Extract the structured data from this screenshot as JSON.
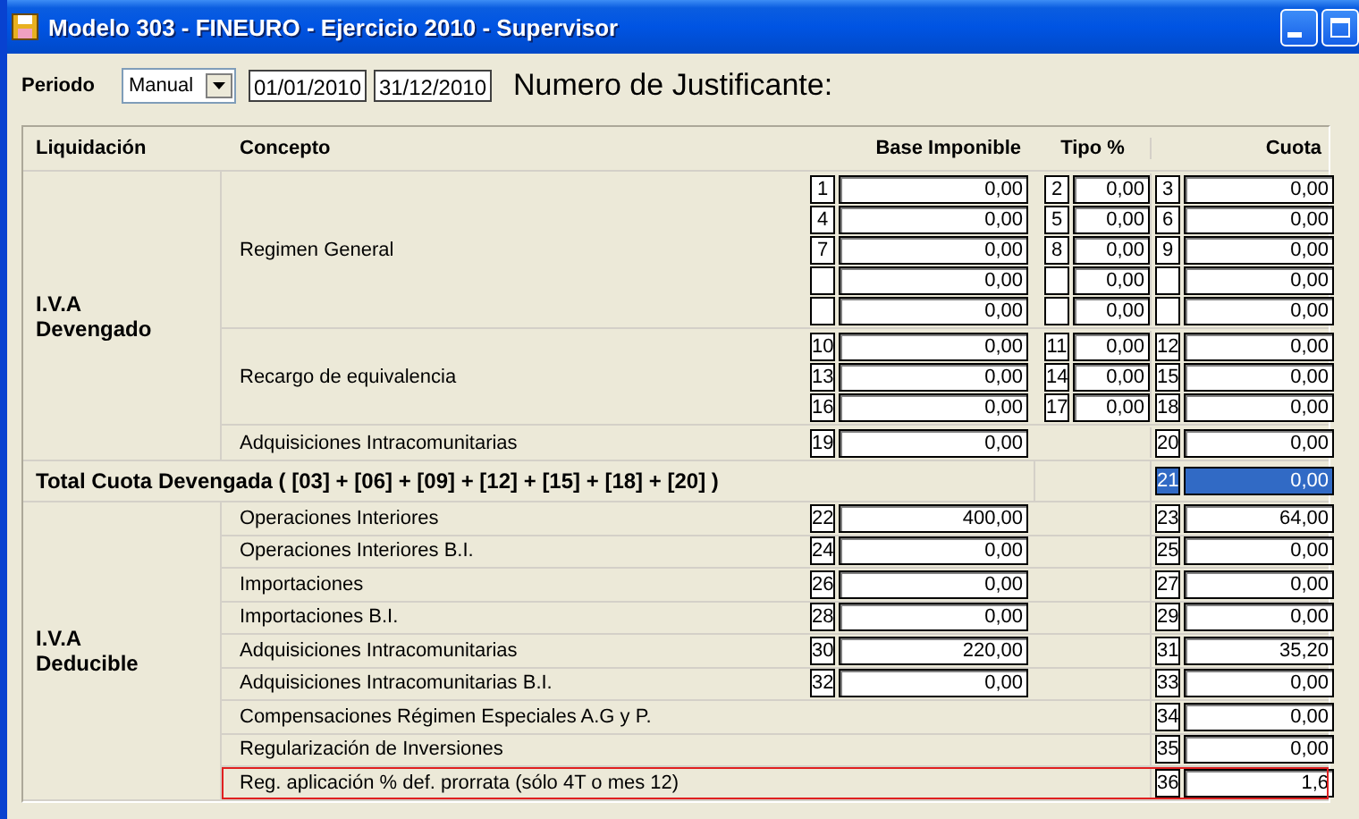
{
  "window": {
    "title": "Modelo 303 - FINEURO - Ejercicio 2010 - Supervisor"
  },
  "periodo": {
    "label": "Periodo",
    "mode": "Manual",
    "from": "01/01/2010",
    "to": "31/12/2010"
  },
  "justificante": "Numero de Justificante:",
  "table": {
    "columns": [
      "Liquidación",
      "Concepto",
      "Base Imponible",
      "Tipo %",
      "Cuota"
    ],
    "sections": [
      {
        "kind": "group",
        "title": "I.V.A Devengado",
        "concepts": [
          {
            "label": "Regimen General",
            "highlighted": false,
            "lines": [
              {
                "base": {
                  "num": "1",
                  "value": "0,00"
                },
                "tipo": {
                  "num": "2",
                  "value": "0,00"
                },
                "cuota": {
                  "num": "3",
                  "value": "0,00"
                }
              },
              {
                "base": {
                  "num": "4",
                  "value": "0,00"
                },
                "tipo": {
                  "num": "5",
                  "value": "0,00"
                },
                "cuota": {
                  "num": "6",
                  "value": "0,00"
                }
              },
              {
                "base": {
                  "num": "7",
                  "value": "0,00"
                },
                "tipo": {
                  "num": "8",
                  "value": "0,00"
                },
                "cuota": {
                  "num": "9",
                  "value": "0,00"
                }
              },
              {
                "base": {
                  "value": "0,00"
                },
                "tipo": {
                  "value": "0,00"
                },
                "cuota": {
                  "value": "0,00"
                }
              },
              {
                "base": {
                  "value": "0,00"
                },
                "tipo": {
                  "value": "0,00"
                },
                "cuota": {
                  "value": "0,00"
                }
              }
            ]
          },
          {
            "label": "Recargo de equivalencia",
            "highlighted": false,
            "lines": [
              {
                "base": {
                  "num": "10",
                  "value": "0,00"
                },
                "tipo": {
                  "num": "11",
                  "value": "0,00"
                },
                "cuota": {
                  "num": "12",
                  "value": "0,00"
                }
              },
              {
                "base": {
                  "num": "13",
                  "value": "0,00"
                },
                "tipo": {
                  "num": "14",
                  "value": "0,00"
                },
                "cuota": {
                  "num": "15",
                  "value": "0,00"
                }
              },
              {
                "base": {
                  "num": "16",
                  "value": "0,00"
                },
                "tipo": {
                  "num": "17",
                  "value": "0,00"
                },
                "cuota": {
                  "num": "18",
                  "value": "0,00"
                }
              }
            ]
          },
          {
            "label": "Adquisiciones Intracomunitarias",
            "highlighted": false,
            "lines": [
              {
                "base": {
                  "num": "19",
                  "value": "0,00"
                },
                "cuota": {
                  "num": "20",
                  "value": "0,00"
                }
              }
            ]
          }
        ]
      },
      {
        "kind": "total",
        "label": "Total Cuota Devengada ( [03] + [06] + [09] + [12] + [15] + [18] + [20] )",
        "cuota": {
          "num": "21",
          "value": "0,00",
          "selected": true
        }
      },
      {
        "kind": "group",
        "title": "I.V.A Deducible",
        "concepts": [
          {
            "label": "Operaciones Interiores",
            "highlighted": false,
            "lines": [
              {
                "base": {
                  "num": "22",
                  "value": "400,00"
                },
                "cuota": {
                  "num": "23",
                  "value": "64,00"
                }
              }
            ]
          },
          {
            "label": "Operaciones Interiores B.I.",
            "highlighted": false,
            "lines": [
              {
                "base": {
                  "num": "24",
                  "value": "0,00"
                },
                "cuota": {
                  "num": "25",
                  "value": "0,00"
                }
              }
            ]
          },
          {
            "label": "Importaciones",
            "highlighted": false,
            "lines": [
              {
                "base": {
                  "num": "26",
                  "value": "0,00"
                },
                "cuota": {
                  "num": "27",
                  "value": "0,00"
                }
              }
            ]
          },
          {
            "label": "Importaciones B.I.",
            "highlighted": false,
            "lines": [
              {
                "base": {
                  "num": "28",
                  "value": "0,00"
                },
                "cuota": {
                  "num": "29",
                  "value": "0,00"
                }
              }
            ]
          },
          {
            "label": "Adquisiciones Intracomunitarias",
            "highlighted": false,
            "lines": [
              {
                "base": {
                  "num": "30",
                  "value": "220,00"
                },
                "cuota": {
                  "num": "31",
                  "value": "35,20"
                }
              }
            ]
          },
          {
            "label": "Adquisiciones Intracomunitarias B.I.",
            "highlighted": false,
            "lines": [
              {
                "base": {
                  "num": "32",
                  "value": "0,00"
                },
                "cuota": {
                  "num": "33",
                  "value": "0,00"
                }
              }
            ]
          },
          {
            "label": "Compensaciones Régimen Especiales A.G y P.",
            "highlighted": false,
            "lines": [
              {
                "cuota": {
                  "num": "34",
                  "value": "0,00"
                }
              }
            ]
          },
          {
            "label": "Regularización de Inversiones",
            "highlighted": false,
            "lines": [
              {
                "cuota": {
                  "num": "35",
                  "value": "0,00"
                }
              }
            ]
          },
          {
            "label": "Reg. aplicación % def. prorrata (sólo 4T o mes 12)",
            "highlighted": true,
            "lines": [
              {
                "cuota": {
                  "num": "36",
                  "value": "1,6"
                }
              }
            ]
          }
        ]
      }
    ]
  }
}
